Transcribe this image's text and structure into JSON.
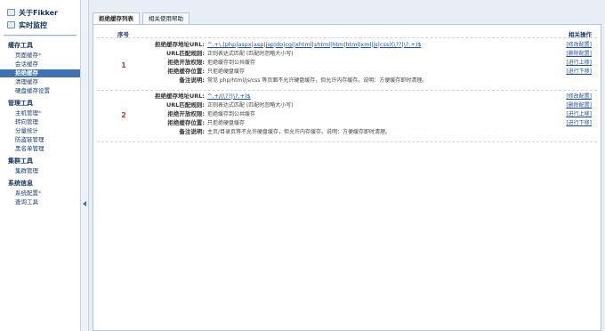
{
  "sidebar": {
    "top_items": [
      {
        "label": "关于Fikker",
        "icon": "info-icon"
      },
      {
        "label": "实时监控",
        "icon": "monitor-icon"
      }
    ],
    "groups": [
      {
        "title": "缓存工具",
        "items": [
          {
            "label": "页面缓存",
            "star": "*"
          },
          {
            "label": "会话缓存",
            "star": ""
          },
          {
            "label": "拒绝缓存",
            "star": "",
            "active": true
          },
          {
            "label": "清理缓存",
            "star": ""
          },
          {
            "label": "硬盘缓存设置",
            "star": ""
          }
        ]
      },
      {
        "title": "管理工具",
        "items": [
          {
            "label": "主机管理",
            "star": "*"
          },
          {
            "label": "转向管理",
            "star": ""
          },
          {
            "label": "分量统计",
            "star": ""
          },
          {
            "label": "防盗链管理",
            "star": ""
          },
          {
            "label": "黑名单管理",
            "star": ""
          }
        ]
      },
      {
        "title": "集群工具",
        "items": [
          {
            "label": "集群管理",
            "star": ""
          }
        ]
      },
      {
        "title": "系统信息",
        "items": [
          {
            "label": "系统配置",
            "star": "*"
          },
          {
            "label": "查询工具",
            "star": ""
          }
        ]
      }
    ],
    "accent": "#3d73b0"
  },
  "tabs": [
    {
      "label": "拒绝缓存列表",
      "active": true
    },
    {
      "label": "相关使用帮助",
      "active": false
    }
  ],
  "table": {
    "col_seq": "序号",
    "col_actions": "相关操作",
    "labels": {
      "url": "拒绝缓存地址URL:",
      "rule": "URL匹配规则:",
      "perm": "拒绝开放权限:",
      "pos": "拒绝缓存位置:",
      "note": "备注说明:"
    },
    "actions": [
      "[修改配置]",
      "[删除配置]",
      "[进行上移]",
      "[进行下移]"
    ],
    "records": [
      {
        "num": "1",
        "url": "^.+\\.(php|aspx|asp|jsp|do|cgi|xhtml|shtml|htm|html|xml|js|css)(\\??|\\?.+)$",
        "rule": "正则表达式匹配 (匹配时忽略大小写)",
        "perm": "拒绝缓存到公共缓存",
        "pos": "只拒绝硬盘缓存",
        "note": "常见 php/html/js/css 等页面不允许硬盘缓存，但允许内存缓存。说明：方便缓存即时清理。"
      },
      {
        "num": "2",
        "url": "^.+/(\\??|\\?.+)$",
        "rule": "正则表达式匹配 (匹配时忽略大小写)",
        "perm": "拒绝缓存到公共缓存",
        "pos": "只拒绝硬盘缓存",
        "note": "主页/目录页等不允许硬盘缓存，但允许内存缓存。说明：方便缓存即时清理。"
      }
    ]
  }
}
